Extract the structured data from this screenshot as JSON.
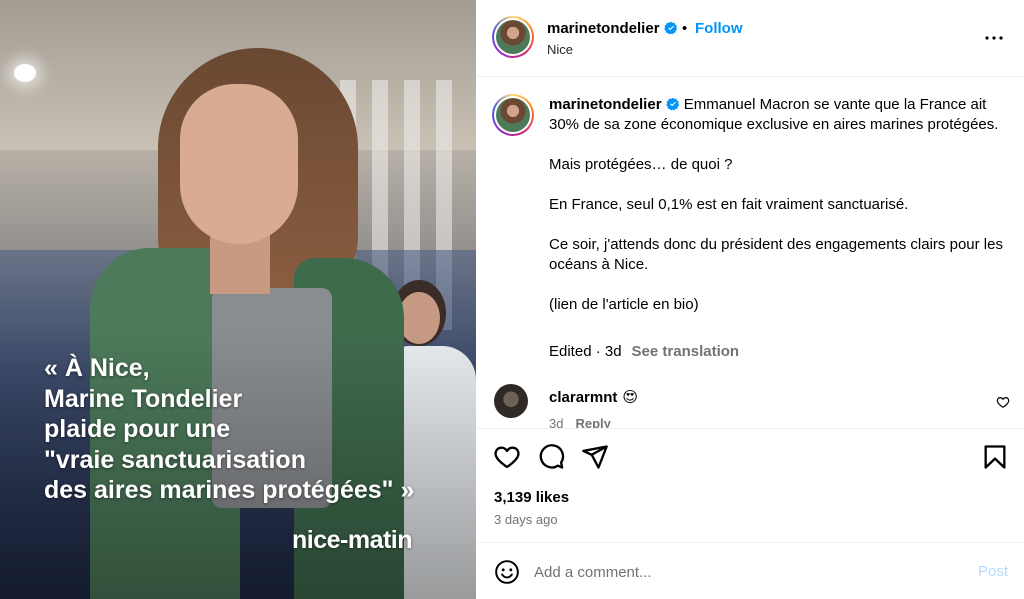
{
  "media": {
    "quote_lines": [
      "« À Nice,",
      "Marine Tondelier",
      "plaide pour une",
      "\"vraie sanctuarisation",
      "des aires marines protégées\" »"
    ],
    "watermark": "nice-matin"
  },
  "header": {
    "username": "marinetondelier",
    "verified_icon": "verified-badge-icon",
    "separator": "•",
    "follow_label": "Follow",
    "location": "Nice",
    "more_icon": "more-options-icon"
  },
  "caption": {
    "username": "marinetondelier",
    "paragraphs": [
      "Emmanuel Macron se vante que la France ait 30% de sa zone économique exclusive en aires marines protégées.",
      "Mais protégées… de quoi ?",
      "En France, seul 0,1% est en fait vraiment sanctuarisé.",
      "Ce soir, j'attends donc du président des engagements clairs pour les océans à Nice.",
      "(lien de l'article en bio)"
    ],
    "meta": "Edited · 3d",
    "see_translation": "See translation"
  },
  "comment": {
    "username": "clararmnt",
    "emoji": "😍",
    "time": "3d",
    "reply_label": "Reply"
  },
  "actions": {
    "like_icon": "heart-icon",
    "comment_icon": "comment-icon",
    "share_icon": "share-icon",
    "save_icon": "bookmark-icon"
  },
  "likes": "3,139 likes",
  "time_ago": "3 days ago",
  "add_comment": {
    "placeholder": "Add a comment...",
    "post_label": "Post"
  },
  "colors": {
    "accent": "#0095f6",
    "post_disabled": "#b3dbff",
    "muted": "#737373"
  }
}
